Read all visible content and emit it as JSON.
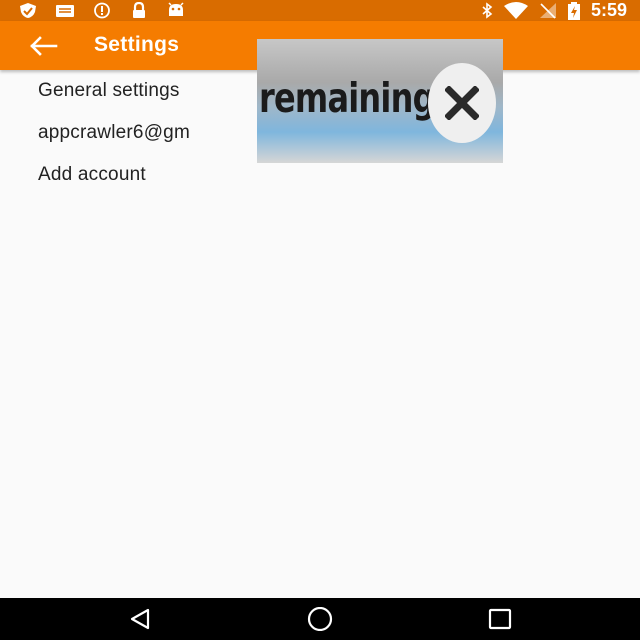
{
  "status_bar": {
    "time": "5:59",
    "left_icons": [
      "shield-icon",
      "mail-icon",
      "alert-icon",
      "lock-icon",
      "android-icon"
    ],
    "right_icons": [
      "bluetooth-icon",
      "wifi-icon",
      "no-sim-icon",
      "battery-charging-icon"
    ]
  },
  "app_bar": {
    "title": "Settings",
    "back_icon": "arrow-left-icon",
    "color": "#f57c00"
  },
  "settings_list": {
    "items": [
      {
        "label": "General settings"
      },
      {
        "label": "appcrawler6@gm"
      },
      {
        "label": "Add account"
      }
    ]
  },
  "ad_overlay": {
    "text": "remaining",
    "close_icon": "close-icon"
  },
  "nav_bar": {
    "buttons": [
      "back-triangle-icon",
      "home-circle-icon",
      "recents-square-icon"
    ]
  }
}
